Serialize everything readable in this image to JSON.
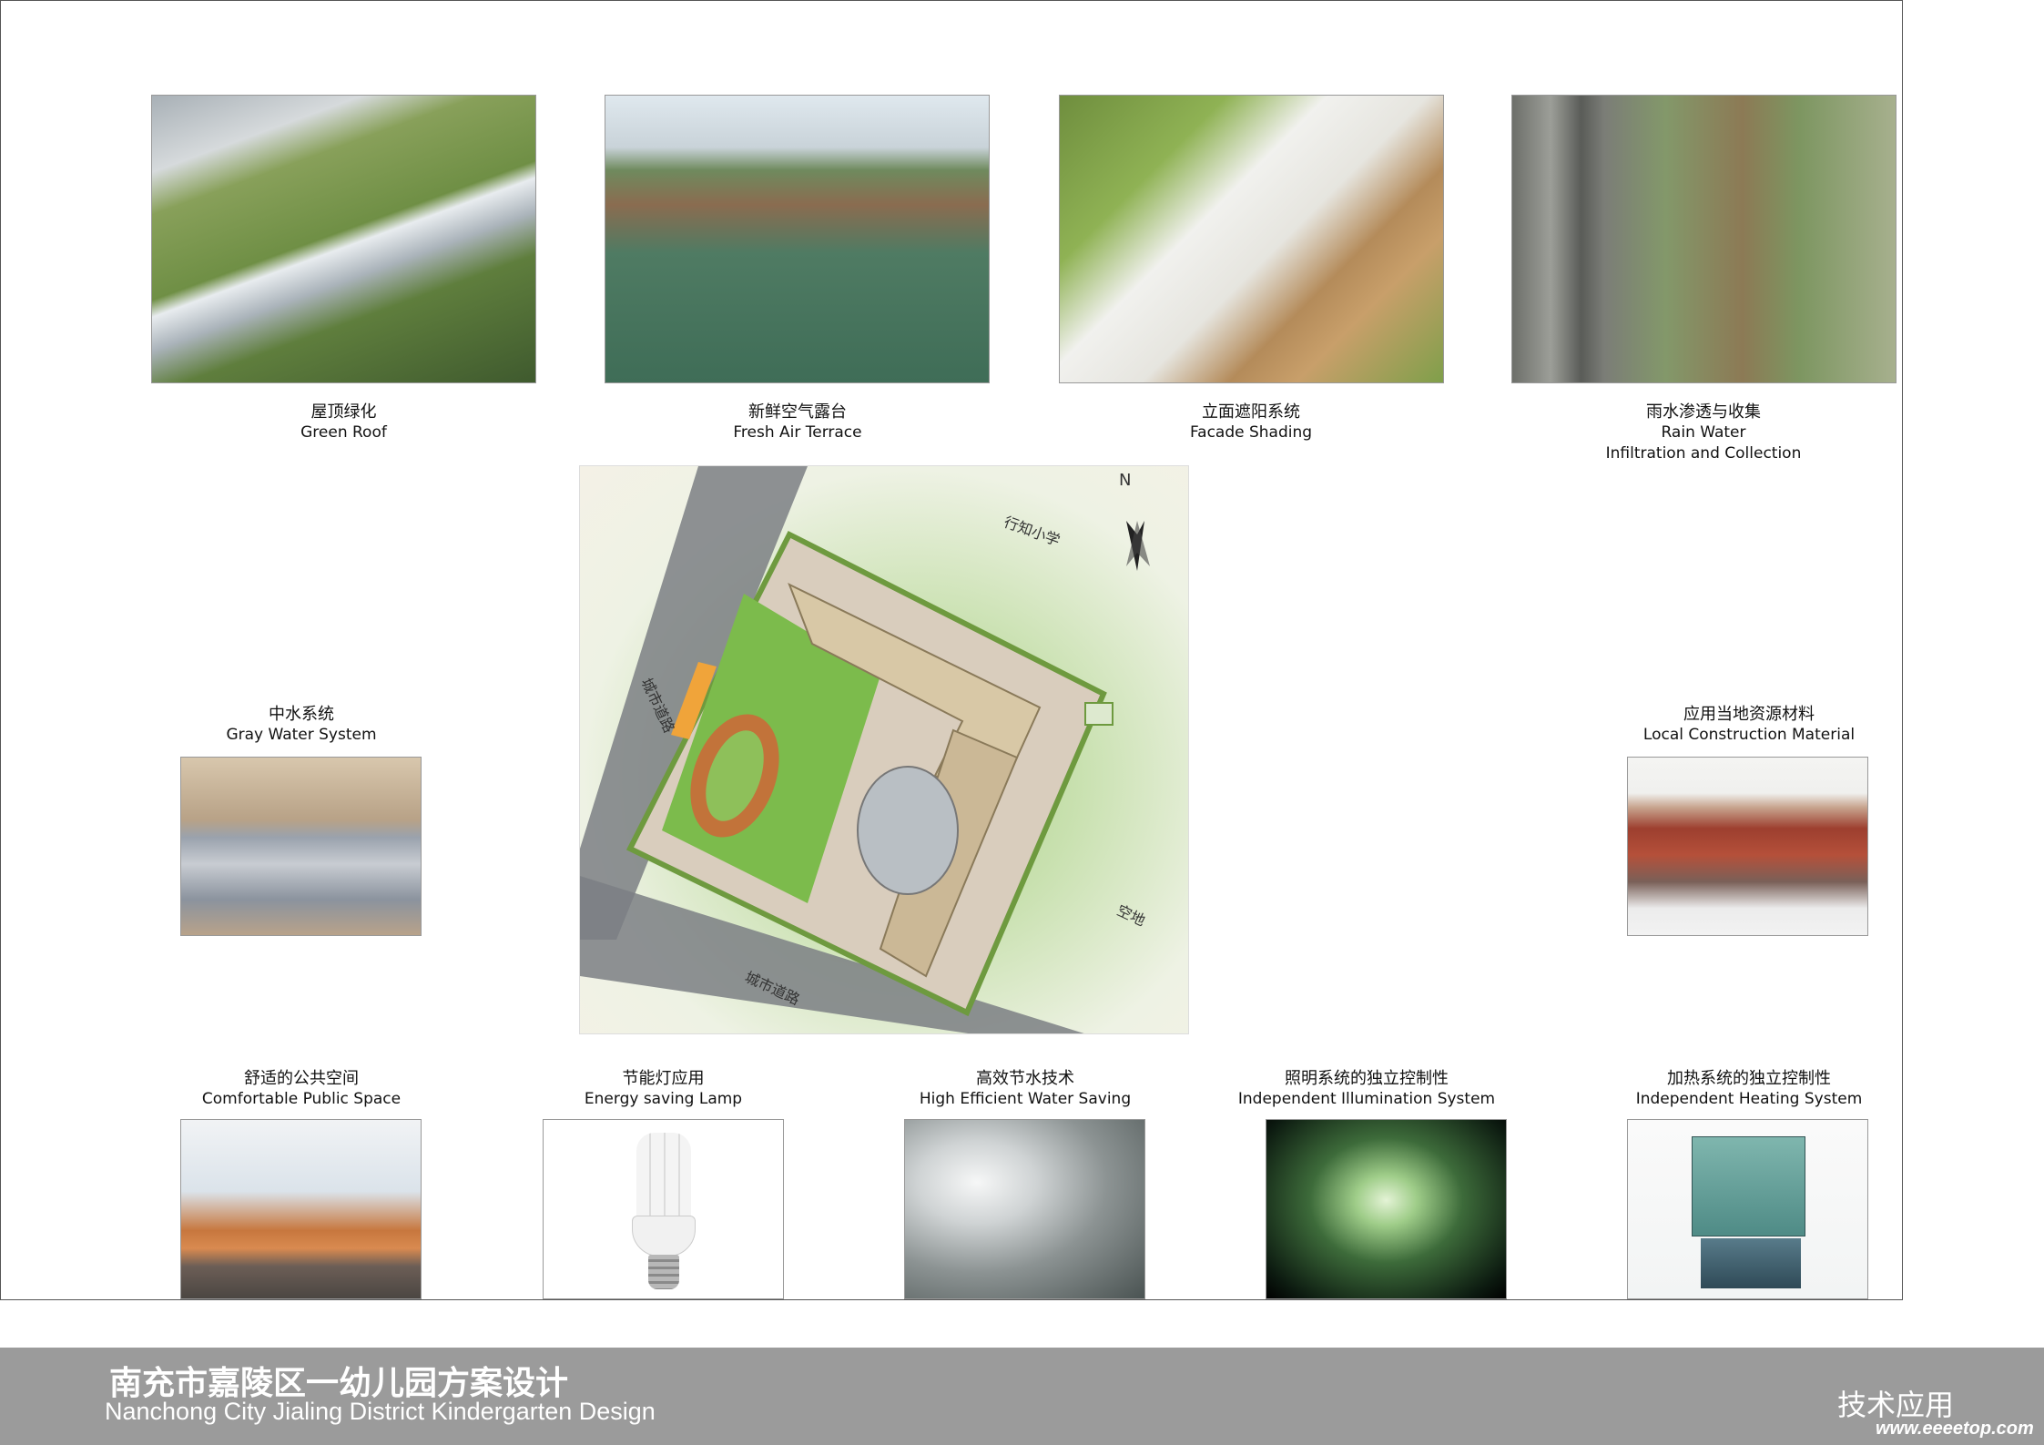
{
  "top_row": [
    {
      "cn": "屋顶绿化",
      "en": "Green Roof",
      "icon": "green-roof-photo"
    },
    {
      "cn": "新鲜空气露台",
      "en": "Fresh Air Terrace",
      "icon": "terrace-photo"
    },
    {
      "cn": "立面遮阳系统",
      "en": "Facade Shading",
      "icon": "facade-shading-photo"
    },
    {
      "cn": "雨水渗透与收集",
      "en": "Rain Water",
      "en2": "Infiltration and Collection",
      "icon": "rain-water-photo"
    }
  ],
  "middle_left": {
    "cn": "中水系统",
    "en": "Gray Water System"
  },
  "middle_right": {
    "cn": "应用当地资源材料",
    "en": "Local Construction Material"
  },
  "bottom_row": [
    {
      "cn": "舒适的公共空间",
      "en": "Comfortable Public Space"
    },
    {
      "cn": "节能灯应用",
      "en": "Energy saving Lamp"
    },
    {
      "cn": "高效节水技术",
      "en": "High Efficient Water Saving"
    },
    {
      "cn": "照明系统的独立控制性",
      "en": "Independent Illumination System"
    },
    {
      "cn": "加热系统的独立控制性",
      "en": "Independent Heating System"
    }
  ],
  "site_plan": {
    "north": "N",
    "school": "行知小学",
    "road_left": "城市道路",
    "road_bottom": "城市道路",
    "empty_land": "空地"
  },
  "footer": {
    "title_cn": "南充市嘉陵区一幼儿园方案设计",
    "title_en": "Nanchong City Jialing District Kindergarten Design",
    "section": "技术应用",
    "website": "www.eeeetop.com"
  }
}
